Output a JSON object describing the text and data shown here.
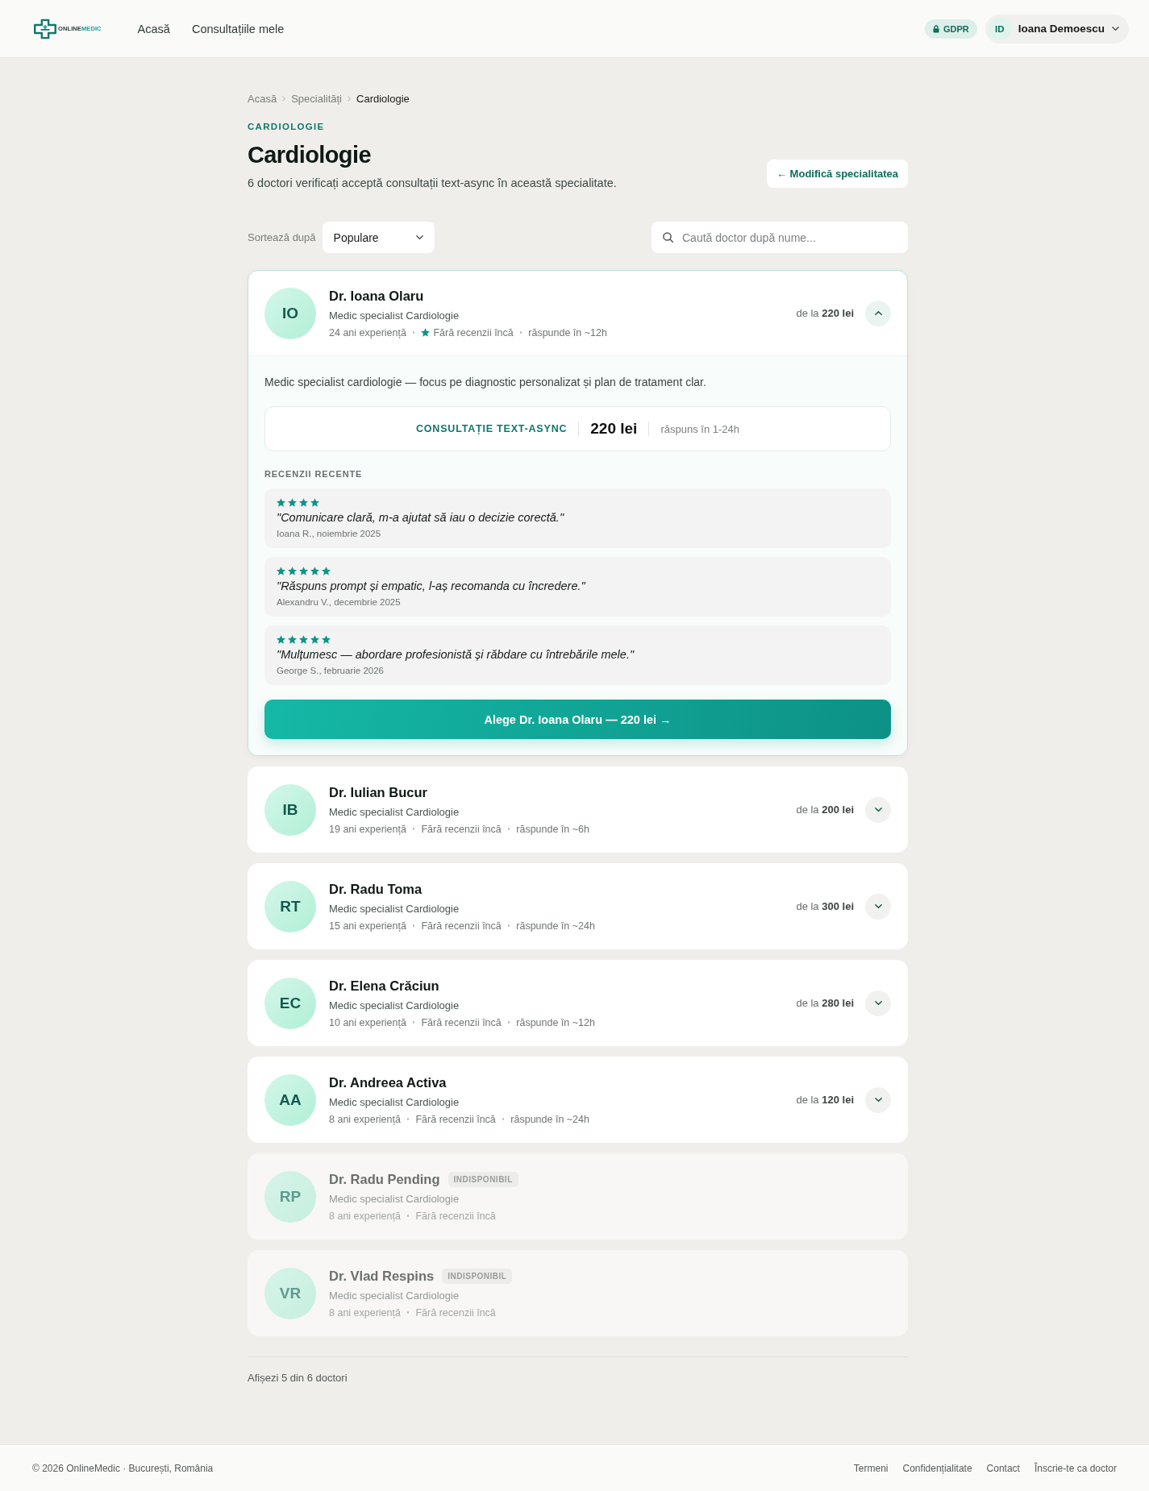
{
  "header": {
    "logo": {
      "text": "ONLINE",
      "accent_text": "MEDIC"
    },
    "nav": [
      {
        "label": "Acasă"
      },
      {
        "label": "Consultațiile mele"
      }
    ],
    "gdpr_badge": "GDPR",
    "user": {
      "initials": "ID",
      "name": "Ioana Demoescu"
    }
  },
  "breadcrumb": [
    {
      "label": "Acasă",
      "current": false
    },
    {
      "label": "Specialități",
      "current": false
    },
    {
      "label": "Cardiologie",
      "current": true
    }
  ],
  "eyebrow": "CARDIOLOGIE",
  "title": "Cardiologie",
  "subtitle": "6 doctori verificați acceptă consultații text-async în această specialitate.",
  "change_button": "← Modifică specialitatea",
  "sort": {
    "label": "Sortează după",
    "value": "Populare"
  },
  "search": {
    "placeholder": "Caută doctor după nume..."
  },
  "doctors": [
    {
      "initials": "IO",
      "name": "Dr. Ioana Olaru",
      "specialty": "Medic specialist Cardiologie",
      "meta": [
        {
          "text": "24 ani experiență",
          "star": false
        },
        {
          "text": "Fără recenzii încă",
          "star": true
        },
        {
          "text": "răspunde în ~12h",
          "star": false
        }
      ],
      "available": true,
      "price_prefix": "de la",
      "price": "220 lei",
      "expanded": true,
      "details": {
        "description": "Medic specialist cardiologie — focus pe diagnostic personalizat și plan de tratament clar.",
        "offer": {
          "label": "CONSULTAȚIE TEXT-ASYNC",
          "price": "220 lei",
          "response": "răspuns în 1-24h"
        },
        "reviews_heading": "RECENZII RECENTE",
        "reviews": [
          {
            "stars": 4,
            "quote": "\"Comunicare clară, m-a ajutat să iau o decizie corectă.\"",
            "author": "Ioana R., noiembrie 2025"
          },
          {
            "stars": 5,
            "quote": "\"Răspuns prompt și empatic, l-aș recomanda cu încredere.\"",
            "author": "Alexandru V., decembrie 2025"
          },
          {
            "stars": 5,
            "quote": "\"Mulțumesc — abordare profesionistă și răbdare cu întrebările mele.\"",
            "author": "George S., februarie 2026"
          }
        ],
        "cta": "Alege Dr. Ioana Olaru — 220 lei →"
      }
    },
    {
      "initials": "IB",
      "name": "Dr. Iulian Bucur",
      "specialty": "Medic specialist Cardiologie",
      "meta": [
        {
          "text": "19 ani experiență",
          "star": false
        },
        {
          "text": "Fără recenzii încă",
          "star": false
        },
        {
          "text": "răspunde în ~6h",
          "star": false
        }
      ],
      "available": true,
      "price_prefix": "de la",
      "price": "200 lei",
      "expanded": false
    },
    {
      "initials": "RT",
      "name": "Dr. Radu Toma",
      "specialty": "Medic specialist Cardiologie",
      "meta": [
        {
          "text": "15 ani experiență",
          "star": false
        },
        {
          "text": "Fără recenzii încă",
          "star": false
        },
        {
          "text": "răspunde în ~24h",
          "star": false
        }
      ],
      "available": true,
      "price_prefix": "de la",
      "price": "300 lei",
      "expanded": false
    },
    {
      "initials": "EC",
      "name": "Dr. Elena Crăciun",
      "specialty": "Medic specialist Cardiologie",
      "meta": [
        {
          "text": "10 ani experiență",
          "star": false
        },
        {
          "text": "Fără recenzii încă",
          "star": false
        },
        {
          "text": "răspunde în ~12h",
          "star": false
        }
      ],
      "available": true,
      "price_prefix": "de la",
      "price": "280 lei",
      "expanded": false
    },
    {
      "initials": "AA",
      "name": "Dr. Andreea Activa",
      "specialty": "Medic specialist Cardiologie",
      "meta": [
        {
          "text": "8 ani experiență",
          "star": false
        },
        {
          "text": "Fără recenzii încă",
          "star": false
        },
        {
          "text": "răspunde în ~24h",
          "star": false
        }
      ],
      "available": true,
      "price_prefix": "de la",
      "price": "120 lei",
      "expanded": false
    },
    {
      "initials": "RP",
      "name": "Dr. Radu Pending",
      "badge": "INDISPONIBIL",
      "specialty": "Medic specialist Cardiologie",
      "meta": [
        {
          "text": "8 ani experiență",
          "star": false
        },
        {
          "text": "Fără recenzii încă",
          "star": false
        }
      ],
      "available": false
    },
    {
      "initials": "VR",
      "name": "Dr. Vlad Respins",
      "badge": "INDISPONIBIL",
      "specialty": "Medic specialist Cardiologie",
      "meta": [
        {
          "text": "8 ani experiență",
          "star": false
        },
        {
          "text": "Fără recenzii încă",
          "star": false
        }
      ],
      "available": false
    }
  ],
  "results_count": "Afișezi 5 din 6 doctori",
  "footer": {
    "copyright": "© 2026 OnlineMedic · București, România",
    "links": [
      "Termeni",
      "Confidențialitate",
      "Contact",
      "Înscrie-te ca doctor"
    ]
  }
}
